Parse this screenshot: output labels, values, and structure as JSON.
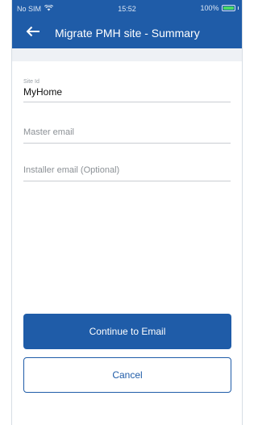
{
  "status_bar": {
    "carrier": "No SIM",
    "time": "15:52",
    "battery": "100%",
    "battery_level": 1.0,
    "wifi_icon": "wifi-icon",
    "battery_color": "#4cd964"
  },
  "header": {
    "back_icon": "arrow-left-icon",
    "title": "Migrate PMH site - Summary",
    "color": "#1f5ca8"
  },
  "form": {
    "site_id": {
      "label": "Site Id",
      "value": "MyHome"
    },
    "master_email": {
      "placeholder": "Master email",
      "value": ""
    },
    "installer_email": {
      "placeholder": "Installer email (Optional)",
      "value": ""
    }
  },
  "actions": {
    "continue_label": "Continue to Email",
    "cancel_label": "Cancel"
  }
}
